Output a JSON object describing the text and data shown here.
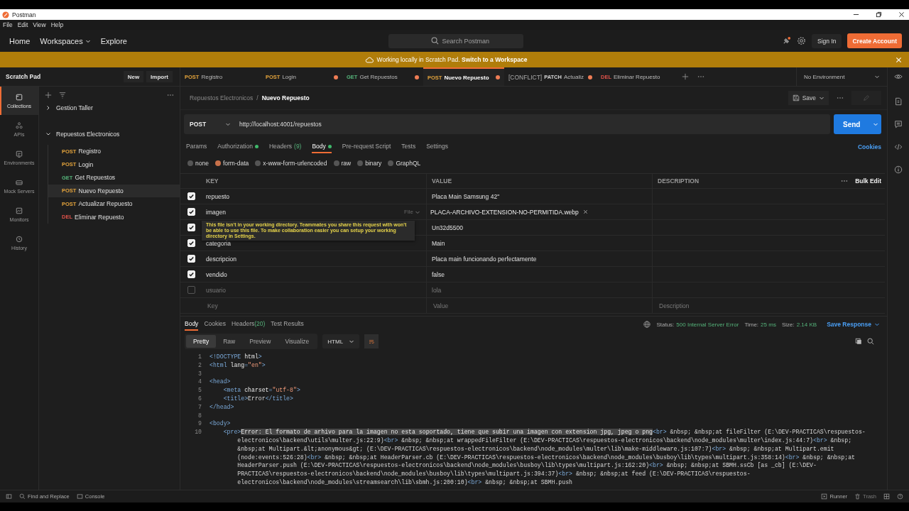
{
  "window": {
    "title": "Postman"
  },
  "menu": [
    "File",
    "Edit",
    "View",
    "Help"
  ],
  "header": {
    "nav": [
      {
        "label": "Home",
        "dropdown": false
      },
      {
        "label": "Workspaces",
        "dropdown": true
      },
      {
        "label": "Explore",
        "dropdown": false
      }
    ],
    "search": {
      "placeholder": "Search Postman"
    },
    "sign_in": "Sign In",
    "create_account": "Create Account"
  },
  "banner": {
    "text": "Working locally in Scratch Pad. **Switch to a Workspace**"
  },
  "sidebar": {
    "title": "Scratch Pad",
    "new": "New",
    "import": "Import",
    "rail": [
      {
        "label": "Collections",
        "selected": true
      },
      {
        "label": "APIs",
        "selected": false
      },
      {
        "label": "Environments",
        "selected": false
      },
      {
        "label": "Mock Servers",
        "selected": false
      },
      {
        "label": "Monitors",
        "selected": false
      },
      {
        "label": "History",
        "selected": false
      }
    ],
    "collections": [
      {
        "name": "Gestion Taller",
        "expanded": false
      },
      {
        "name": "Repuestos Electronicos",
        "expanded": true,
        "children": [
          {
            "method": "POST",
            "name": "Registro",
            "selected": false
          },
          {
            "method": "POST",
            "name": "Login",
            "selected": false
          },
          {
            "method": "GET",
            "name": "Get Repuestos",
            "selected": false
          },
          {
            "method": "POST",
            "name": "Nuevo Repuesto",
            "selected": true
          },
          {
            "method": "POST",
            "name": "Actualizar Repuesto",
            "selected": false
          },
          {
            "method": "DEL",
            "name": "Eliminar Repuesto",
            "selected": false
          }
        ]
      }
    ]
  },
  "open_tabs": [
    {
      "method": "POST",
      "name": "Registro",
      "unsaved": false,
      "selected": false
    },
    {
      "method": "POST",
      "name": "Login",
      "unsaved": true,
      "selected": false
    },
    {
      "method": "GET",
      "name": "Get Repuestos",
      "unsaved": true,
      "selected": false
    },
    {
      "method": "POST",
      "name": "Nuevo Repuesto",
      "unsaved": true,
      "selected": true
    },
    {
      "prefix": "[CONFLICT]",
      "method": "PATCH",
      "name": "Actualiz",
      "unsaved": true,
      "selected": false
    },
    {
      "method": "DEL",
      "name": "Eliminar Repuesto",
      "unsaved": false,
      "selected": false
    }
  ],
  "environment": "No Environment",
  "request": {
    "breadcrumb": [
      "Repuestos Electronicos",
      "Nuevo Repuesto"
    ],
    "breadcrumb_separator": "/",
    "save": "Save",
    "method": "POST",
    "url": "http://localhost:4001/repuestos",
    "send": "Send",
    "tabs": [
      {
        "label": "Params",
        "dot": false,
        "selected": false
      },
      {
        "label": "Authorization",
        "dot": true,
        "selected": false
      },
      {
        "label": "Headers",
        "count": "(9)",
        "dot": false,
        "selected": false
      },
      {
        "label": "Body",
        "dot": true,
        "selected": true
      },
      {
        "label": "Pre-request Script",
        "dot": false,
        "selected": false
      },
      {
        "label": "Tests",
        "dot": false,
        "selected": false
      },
      {
        "label": "Settings",
        "dot": false,
        "selected": false
      }
    ],
    "cookies": "Cookies",
    "body_types": [
      {
        "label": "none",
        "selected": false
      },
      {
        "label": "form-data",
        "selected": true
      },
      {
        "label": "x-www-form-urlencoded",
        "selected": false
      },
      {
        "label": "raw",
        "selected": false
      },
      {
        "label": "binary",
        "selected": false
      },
      {
        "label": "GraphQL",
        "selected": false
      }
    ],
    "params": {
      "columns": [
        "KEY",
        "VALUE",
        "DESCRIPTION"
      ],
      "bulk_edit": "Bulk Edit",
      "rows": [
        {
          "kind": "text",
          "checked": true,
          "key": "repuesto",
          "value": "Placa Main Samsung 42\""
        },
        {
          "kind": "file",
          "checked": true,
          "key": "imagen",
          "type": "File",
          "value": "PLACA-ARCHIVO-EXTENSION-NO-PERMITIDA.webp"
        },
        {
          "kind": "text",
          "checked": true,
          "value": "Un32d5500"
        },
        {
          "kind": "text",
          "checked": true,
          "key": "categoria",
          "value": "Main"
        },
        {
          "kind": "text",
          "checked": true,
          "key": "descripcion",
          "value": "Placa main funcionando perfectamente"
        },
        {
          "kind": "text",
          "checked": true,
          "key": "vendido",
          "value": "false"
        },
        {
          "kind": "text",
          "checked": false,
          "key": "usuario",
          "value": "lola"
        }
      ],
      "new_row": [
        {
          "placeholder": "Key"
        },
        {
          "placeholder": "Value"
        },
        {
          "placeholder": "Description"
        }
      ],
      "tooltip": "This file isn't in your working directory. Teammates you share this request with won't be able to use this file. To make collaboration easier you can setup your working directory in Settings."
    }
  },
  "response": {
    "tabs": [
      {
        "label": "Body",
        "selected": true
      },
      {
        "label": "Cookies",
        "selected": false
      },
      {
        "label": "Headers",
        "count": "(20)",
        "selected": false
      },
      {
        "label": "Test Results",
        "selected": false
      }
    ],
    "status": {
      "label": "Status:",
      "value": "500 Internal Server Error"
    },
    "time": {
      "label": "Time:",
      "value": "25 ms"
    },
    "size": {
      "label": "Size:",
      "value": "2.14 KB"
    },
    "save_response": "Save Response",
    "views": [
      {
        "label": "Pretty",
        "selected": true
      },
      {
        "label": "Raw",
        "selected": false
      },
      {
        "label": "Preview",
        "selected": false
      },
      {
        "label": "Visualize",
        "selected": false
      }
    ],
    "format": "HTML",
    "wrap": true,
    "code": [
      {
        "number": "1",
        "segments": [
          {
            "kind": "tag",
            "text": "<!DOCTYPE "
          },
          {
            "kind": "attr",
            "text": "html"
          },
          {
            "kind": "tag",
            "text": ">"
          }
        ]
      },
      {
        "number": "2",
        "segments": [
          {
            "kind": "tag",
            "text": "<html "
          },
          {
            "kind": "attr",
            "text": "lang"
          },
          {
            "kind": "tag",
            "text": "="
          },
          {
            "kind": "string",
            "text": "\"en\""
          },
          {
            "kind": "tag",
            "text": ">"
          }
        ]
      },
      {
        "number": "3"
      },
      {
        "number": "4",
        "segments": [
          {
            "kind": "tag",
            "text": "<head>"
          }
        ]
      },
      {
        "number": "5",
        "segments": [
          {
            "kind": "tag",
            "text": "    <meta "
          },
          {
            "kind": "attr",
            "text": "charset"
          },
          {
            "kind": "tag",
            "text": "="
          },
          {
            "kind": "string",
            "text": "\"utf-8\""
          },
          {
            "kind": "tag",
            "text": ">"
          }
        ]
      },
      {
        "number": "6",
        "segments": [
          {
            "kind": "tag",
            "text": "    <title>"
          },
          {
            "kind": "text",
            "text": "Error"
          },
          {
            "kind": "tag",
            "text": "</title>"
          }
        ]
      },
      {
        "number": "7",
        "segments": [
          {
            "kind": "tag",
            "text": "</head>"
          }
        ]
      },
      {
        "number": "8"
      },
      {
        "number": "9",
        "segments": [
          {
            "kind": "tag",
            "text": "<body>"
          }
        ]
      },
      {
        "number": "10",
        "segments": [
          {
            "kind": "tag",
            "text": "    <pre>"
          },
          {
            "kind": "selected",
            "text": "Error: El formato de arhivo para la imagen no esta soportado, tiene que subir una imagen con extension jpg, jpeg o png"
          },
          {
            "kind": "tag",
            "text": "<br>"
          },
          {
            "kind": "text",
            "text": " &nbsp; &nbsp;at fileFilter (E:\\DEV-PRACTICAS\\respuestos-electronicos\\backend\\utils\\multer.js:22:9)"
          },
          {
            "kind": "tag",
            "text": "<br>"
          },
          {
            "kind": "text",
            "text": " &nbsp; &nbsp;at wrappedFileFilter (E:\\DEV-PRACTICAS\\respuestos-electronicos\\backend\\node_modules\\multer\\index.js:44:7)"
          },
          {
            "kind": "tag",
            "text": "<br>"
          },
          {
            "kind": "text",
            "text": " &nbsp; &nbsp;at Multipart.&lt;anonymous&gt; (E:\\DEV-PRACTICAS\\respuestos-electronicos\\backend\\node_modules\\multer\\lib\\make-middleware.js:107:7)"
          },
          {
            "kind": "tag",
            "text": "<br>"
          },
          {
            "kind": "text",
            "text": " &nbsp; &nbsp;at Multipart.emit (node:events:526:28)"
          },
          {
            "kind": "tag",
            "text": "<br>"
          },
          {
            "kind": "text",
            "text": " &nbsp; &nbsp;at HeaderParser.cb (E:\\DEV-PRACTICAS\\respuestos-electronicos\\backend\\node_modules\\busboy\\lib\\types\\multipart.js:358:14)"
          },
          {
            "kind": "tag",
            "text": "<br>"
          },
          {
            "kind": "text",
            "text": " &nbsp; &nbsp;at HeaderParser.push (E:\\DEV-PRACTICAS\\respuestos-electronicos\\backend\\node_modules\\busboy\\lib\\types\\multipart.js:162:20)"
          },
          {
            "kind": "tag",
            "text": "<br>"
          },
          {
            "kind": "text",
            "text": " &nbsp; &nbsp;at SBMH.ssCb [as _cb] (E:\\DEV-PRACTICAS\\respuestos-electronicos\\backend\\node_modules\\busboy\\lib\\types\\multipart.js:394:37)"
          },
          {
            "kind": "tag",
            "text": "<br>"
          },
          {
            "kind": "text",
            "text": " &nbsp; &nbsp;at feed (E:\\DEV-PRACTICAS\\respuestos-electronicos\\backend\\node_modules\\streamsearch\\lib\\sbmh.js:200:10)"
          },
          {
            "kind": "tag",
            "text": "<br>"
          },
          {
            "kind": "text",
            "text": " &nbsp; &nbsp;at SBMH.push"
          }
        ]
      }
    ]
  },
  "status_bar": {
    "left": [
      {
        "label": "Find and Replace",
        "disabled": false
      },
      {
        "label": "Console",
        "disabled": false
      }
    ],
    "right": [
      {
        "label": "Runner",
        "disabled": false
      },
      {
        "label": "Trash",
        "disabled": true
      }
    ]
  }
}
